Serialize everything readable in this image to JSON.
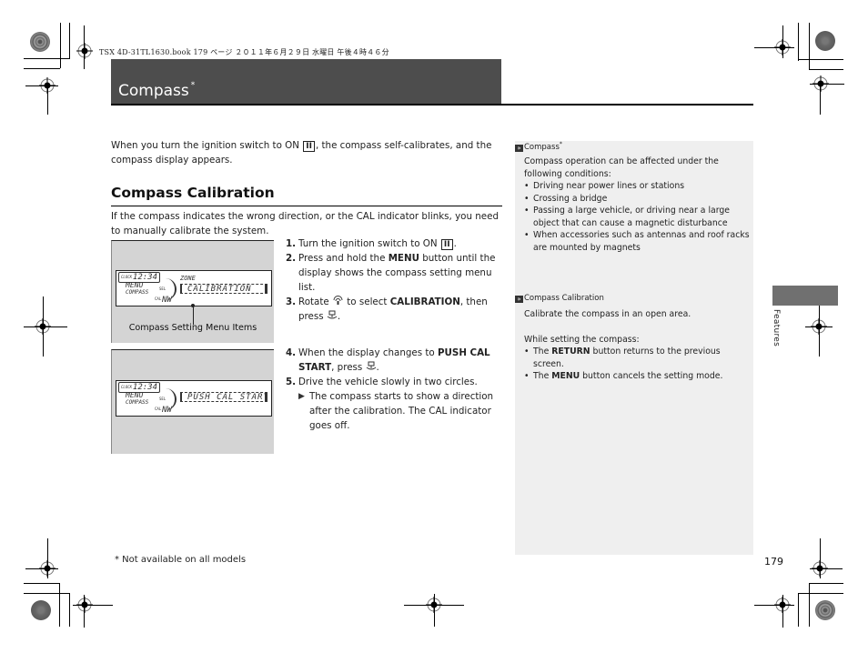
{
  "print_header": {
    "job_line": "TSX 4D-31TL1630.book  179 ページ  ２０１１年６月２９日  水曜日  午後４時４６分"
  },
  "header": {
    "title": "Compass",
    "title_marker": "*"
  },
  "intro": {
    "before_key": "When you turn the ignition switch to ON ",
    "key": "II",
    "after_key": ", the compass self-calibrates, and the compass display appears."
  },
  "section": {
    "heading": "Compass Calibration",
    "intro": "If the compass indicates the wrong direction, or the CAL indicator blinks, you need to manually calibrate the system."
  },
  "figures": [
    {
      "clock_label": "CLOCK",
      "clock": "12:34",
      "menu": "MENU",
      "compass": "COMPASS",
      "sel": "SEL",
      "zone": "ZONE",
      "item": "CALIBRATION",
      "cal": "CAL",
      "direction": "NW",
      "caption": "Compass Setting Menu Items"
    },
    {
      "clock_label": "CLOCK",
      "clock": "12:34",
      "menu": "MENU",
      "compass": "COMPASS",
      "sel": "SEL",
      "item": "PUSH CAL START",
      "cal": "CAL",
      "direction": "NW"
    }
  ],
  "steps": [
    {
      "num": "1.",
      "a": "Turn the ignition switch to ON ",
      "key": "II",
      "b": "."
    },
    {
      "num": "2.",
      "a": "Press and hold the ",
      "bold": "MENU",
      "b": " button until the display shows the compass setting menu list."
    },
    {
      "num": "3.",
      "a": "Rotate ",
      "icon": "selector-knob-rotate-icon",
      "c": " to select ",
      "bold": "CALIBRATION",
      "b": ", then press ",
      "icon2": "selector-knob-press-icon",
      "d": "."
    },
    {
      "num": "4.",
      "a": "When the display changes to ",
      "bold": "PUSH CAL START",
      "b": ", press ",
      "icon": "selector-knob-press-icon",
      "d": "."
    },
    {
      "num": "5.",
      "a": "Drive the vehicle slowly in two circles."
    },
    {
      "sub": "The compass starts to show a direction after the calibration. The CAL indicator goes off."
    }
  ],
  "sidebar": {
    "note1": {
      "title": "Compass",
      "title_marker": "*",
      "text": "Compass operation can be affected under the following conditions:",
      "bullets": [
        "Driving near power lines or stations",
        "Crossing a bridge",
        "Passing a large vehicle, or driving near a large object that can cause a magnetic disturbance",
        "When accessories such as antennas and roof racks are mounted by magnets"
      ]
    },
    "note2": {
      "title": "Compass Calibration",
      "text1": "Calibrate the compass in an open area.",
      "text2": "While setting the compass:",
      "bullets": [
        {
          "pre": "The ",
          "bold": "RETURN",
          "post": " button returns to the previous screen."
        },
        {
          "pre": "The ",
          "bold": "MENU",
          "post": " button cancels the setting mode."
        }
      ]
    }
  },
  "tab": {
    "label": "Features"
  },
  "footnote": "* Not available on all models",
  "page_number": "179",
  "colors": {
    "title_bar": "#4d4d4d",
    "sidebar_bg": "#efefef",
    "figure_bg": "#d4d4d4",
    "tab_block": "#707070"
  }
}
